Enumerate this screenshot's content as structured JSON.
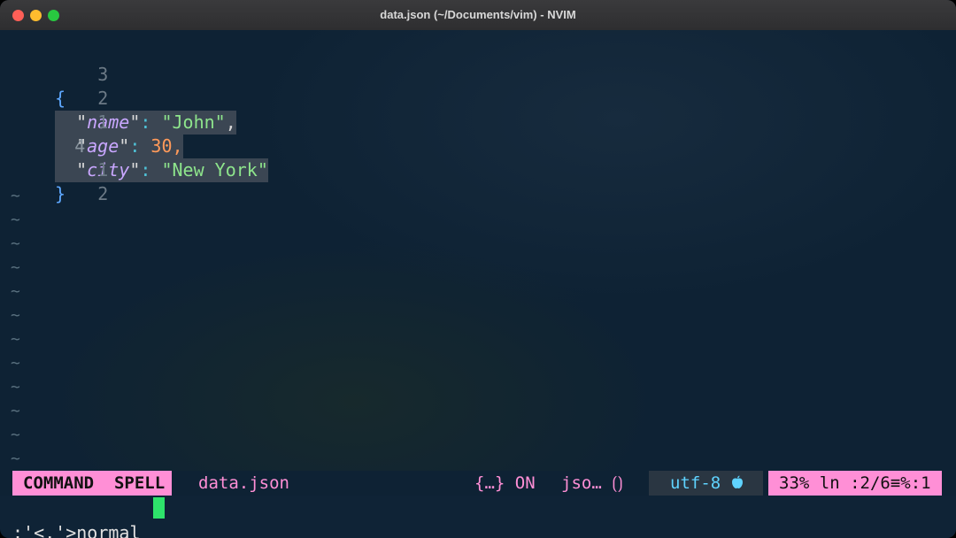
{
  "window": {
    "title": "data.json (~/Documents/vim) - NVIM"
  },
  "buffer": {
    "lines": [
      {
        "number": "3"
      },
      {
        "number": "2",
        "key": "name",
        "value": "John",
        "trail": ","
      },
      {
        "number": "1",
        "key": "age",
        "value": "30",
        "trail": ","
      },
      {
        "number": "4",
        "key": "city",
        "value": "New York",
        "trail": ""
      },
      {
        "number": "1"
      },
      {
        "number": "2"
      }
    ],
    "open_brace": "{",
    "close_brace": "}",
    "tilde": "~"
  },
  "statusline": {
    "mode": "COMMAND  SPELL",
    "filename": "data.json",
    "fold": "{…} ON",
    "filetype": "jso… ⟮⟯",
    "encoding": "utf-8 ",
    "position": "33% ln :2/6≡%:1"
  },
  "cmdline": {
    "text": ":'<,'>normal "
  },
  "colors": {
    "background": "#0e2234",
    "accent_pink": "#ff8fd6",
    "cursor_green": "#2ee36b",
    "key_purple": "#c9a7ff",
    "string_green": "#8ee58c",
    "number_orange": "#ff9a5a"
  }
}
